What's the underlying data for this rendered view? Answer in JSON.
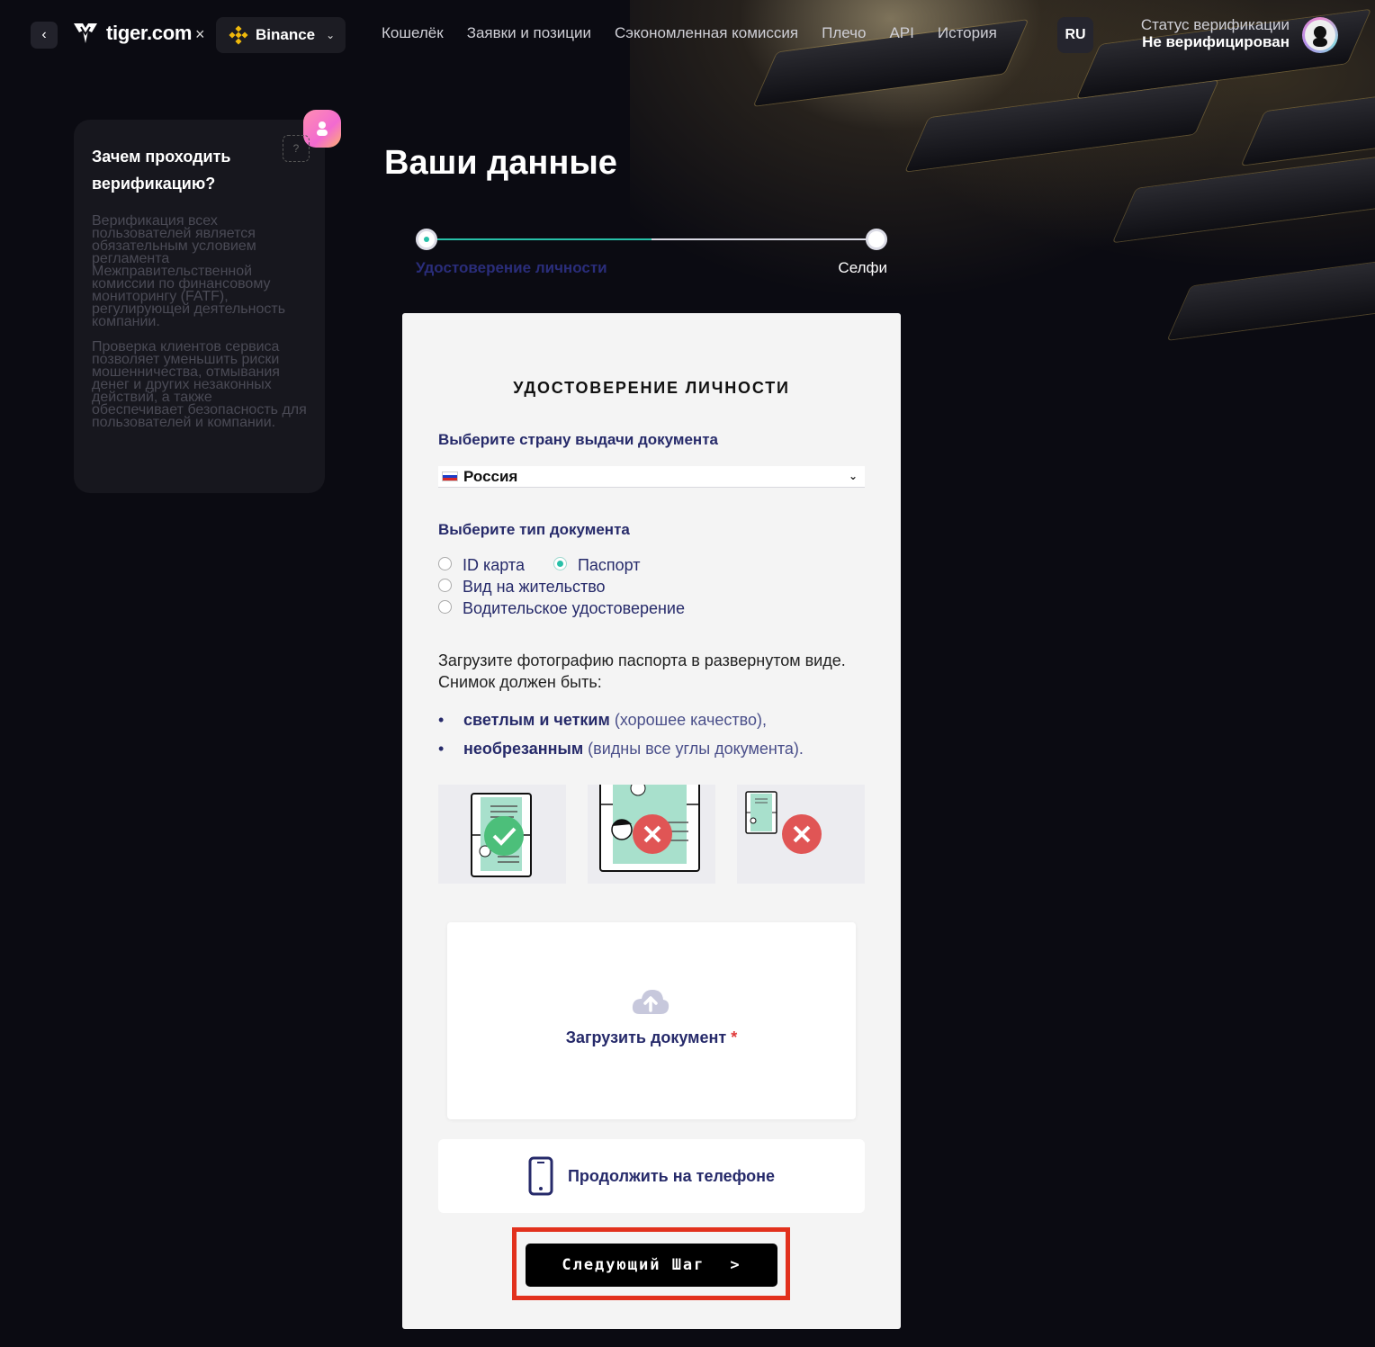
{
  "header": {
    "brand": "tiger.com",
    "separator": "×",
    "exchange": "Binance",
    "nav": [
      "Кошелёк",
      "Заявки и позиции",
      "Сэкономленная комиссия",
      "Плечо",
      "API",
      "История"
    ],
    "lang": "RU",
    "verification_label": "Статус верификации",
    "verification_value": "Не верифицирован"
  },
  "sidebar": {
    "title": "Зачем проходить верификацию?",
    "help": "?",
    "paragraphs": [
      "Верификация всех пользователей является обязательным условием регламента Межправительственной комиссии по финансовому мониторингу (FATF), регулирующей деятельность компании.",
      "Проверка клиентов сервиса позволяет уменьшить риски мошенничества, отмывания денег и других незаконных действий, а также обеспечивает безопасность для пользователей и компании."
    ]
  },
  "page": {
    "title": "Ваши данные",
    "steps": [
      "Удостоверение личности",
      "Селфи"
    ]
  },
  "form": {
    "section_title": "УДОСТОВЕРЕНИЕ ЛИЧНОСТИ",
    "country_label": "Выберите страну выдачи документа",
    "country_value": "Россия",
    "doc_type_label": "Выберите тип документа",
    "doc_types": [
      {
        "label": "ID карта",
        "checked": false
      },
      {
        "label": "Паспорт",
        "checked": true
      },
      {
        "label": "Вид на жительство",
        "checked": false
      },
      {
        "label": "Водительское удостоверение",
        "checked": false
      }
    ],
    "instructions": "Загрузите фотографию паспорта в развернутом виде. Снимок должен быть:",
    "requirements": [
      {
        "bold": "светлым и четким",
        "rest": "(хорошее качество),"
      },
      {
        "bold": "необрезанным",
        "rest": "(видны все углы документа)."
      }
    ],
    "upload_label": "Загрузить документ",
    "upload_required_mark": "*",
    "phone_label": "Продолжить на телефоне",
    "next_label": "Следующий Шаг",
    "next_arrow": ">"
  },
  "colors": {
    "accent_teal": "#27c0a8",
    "text_navy": "#262a6a",
    "highlight_red": "#e2311d",
    "error_red": "#e05555",
    "ok_green": "#4cbf7a"
  }
}
